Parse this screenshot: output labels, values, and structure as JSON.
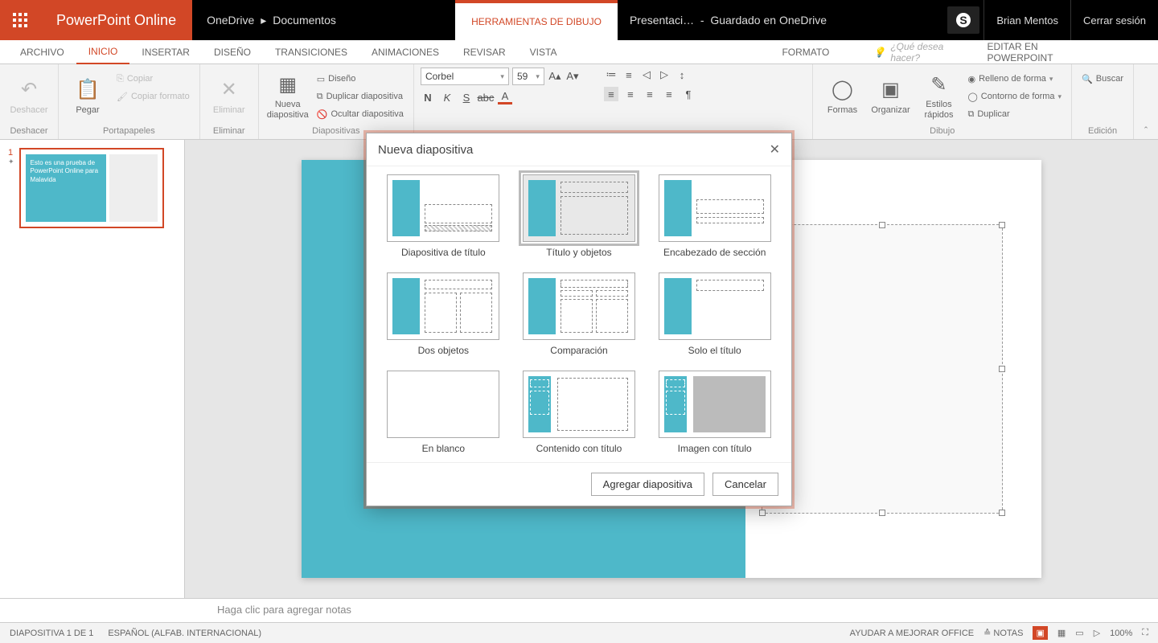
{
  "titlebar": {
    "appname": "PowerPoint Online",
    "bc1": "OneDrive",
    "bc2": "Documentos",
    "contexttab": "HERRAMIENTAS DE DIBUJO",
    "docname": "Presentaci…",
    "sep": "-",
    "saved": "Guardado en OneDrive",
    "user": "Brian Mentos",
    "signout": "Cerrar sesión"
  },
  "tabs": {
    "archivo": "ARCHIVO",
    "inicio": "INICIO",
    "insertar": "INSERTAR",
    "diseno": "DISEÑO",
    "transiciones": "TRANSICIONES",
    "animaciones": "ANIMACIONES",
    "revisar": "REVISAR",
    "vista": "VISTA",
    "formato": "FORMATO",
    "tellme": "¿Qué desea hacer?",
    "editpp": "EDITAR EN POWERPOINT"
  },
  "ribbon": {
    "undo": "Deshacer",
    "undo_grp": "Deshacer",
    "paste": "Pegar",
    "copy": "Copiar",
    "format_painter": "Copiar formato",
    "clipboard_grp": "Portapapeles",
    "delete": "Eliminar",
    "delete_grp": "Eliminar",
    "newslide": "Nueva diapositiva",
    "layout": "Diseño",
    "duplicate": "Duplicar diapositiva",
    "hide": "Ocultar diapositiva",
    "slides_grp": "Diapositivas",
    "fontname": "Corbel",
    "fontsize": "59",
    "shapes": "Formas",
    "arrange": "Organizar",
    "quickstyles": "Estilos rápidos",
    "shapefill": "Relleno de forma",
    "shapeoutline": "Contorno de forma",
    "dup": "Duplicar",
    "drawing_grp": "Dibujo",
    "find": "Buscar",
    "editing_grp": "Edición"
  },
  "thumb": {
    "num": "1",
    "text": "Esto es una prueba de PowerPoint Online para Malavida"
  },
  "dialog": {
    "title": "Nueva diapositiva",
    "layouts": [
      "Diapositiva de título",
      "Título y objetos",
      "Encabezado de sección",
      "Dos objetos",
      "Comparación",
      "Solo el título",
      "En blanco",
      "Contenido con título",
      "Imagen con título"
    ],
    "add": "Agregar diapositiva",
    "cancel": "Cancelar"
  },
  "notes": "Haga clic para agregar notas",
  "status": {
    "slide": "DIAPOSITIVA 1 DE 1",
    "lang": "ESPAÑOL (ALFAB. INTERNACIONAL)",
    "help": "AYUDAR A MEJORAR OFFICE",
    "notes": "NOTAS",
    "zoom": "100%"
  }
}
